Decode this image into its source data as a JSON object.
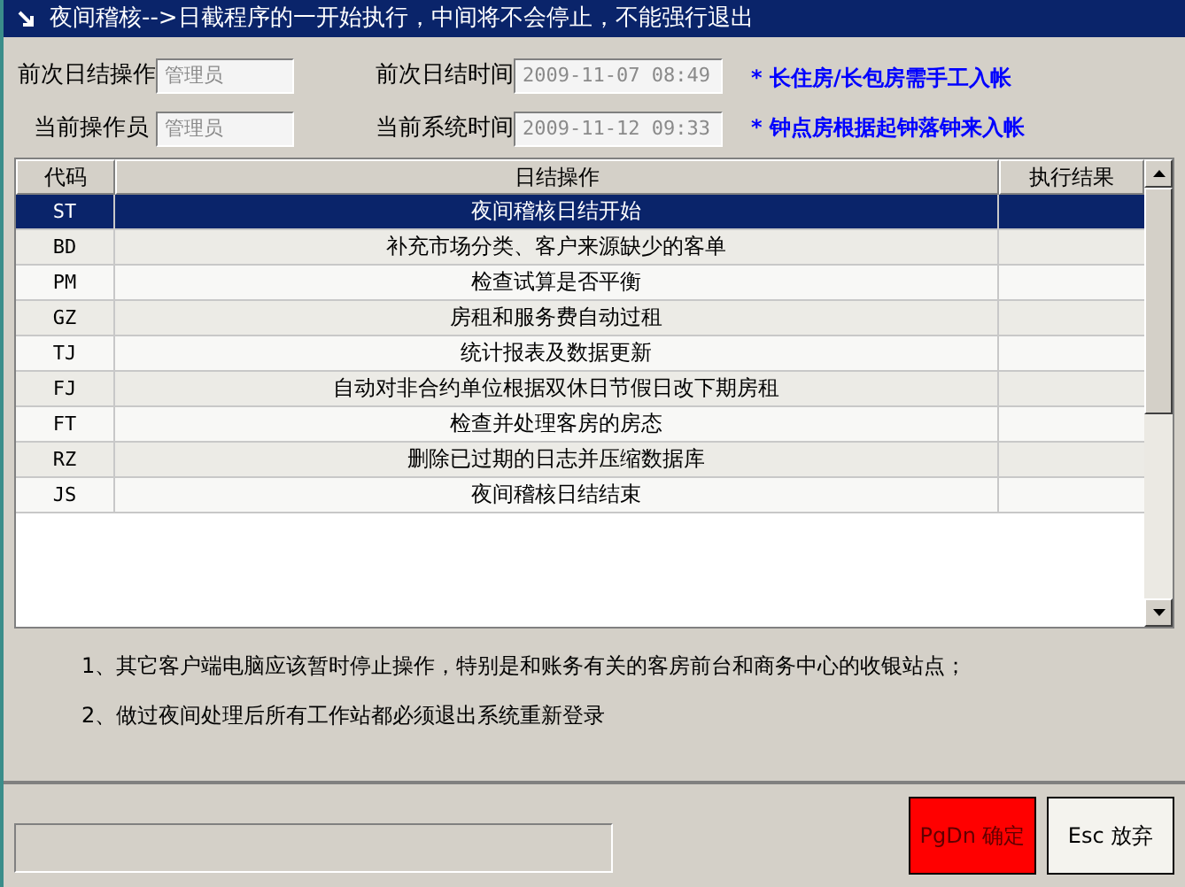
{
  "window": {
    "title": "夜间稽核-->日截程序的一开始执行，中间将不会停止，不能强行退出"
  },
  "fields": [
    {
      "label": "前次日结操作",
      "value": "管理员"
    },
    {
      "label": "前次日结时间",
      "value": "2009-11-07 08:49"
    },
    {
      "label": "当前操作员",
      "value": "管理员"
    },
    {
      "label": "当前系统时间",
      "value": "2009-11-12 09:33"
    }
  ],
  "notices": [
    "* 长住房/长包房需手工入帐",
    "* 钟点房根据起钟落钟来入帐"
  ],
  "table": {
    "columns": [
      "代码",
      "日结操作",
      "执行结果"
    ],
    "rows": [
      {
        "code": "ST",
        "operation": "夜间稽核日结开始",
        "selected": true
      },
      {
        "code": "BD",
        "operation": "补充市场分类、客户来源缺少的客单",
        "selected": false
      },
      {
        "code": "PM",
        "operation": "检查试算是否平衡",
        "selected": false
      },
      {
        "code": "GZ",
        "operation": "房租和服务费自动过租",
        "selected": false
      },
      {
        "code": "TJ",
        "operation": "统计报表及数据更新",
        "selected": false
      },
      {
        "code": "FJ",
        "operation": "自动对非合约单位根据双休日节假日改下期房租",
        "selected": false
      },
      {
        "code": "FT",
        "operation": "检查并处理客房的房态",
        "selected": false
      },
      {
        "code": "RZ",
        "operation": "删除已过期的日志并压缩数据库",
        "selected": false
      },
      {
        "code": "JS",
        "operation": "夜间稽核日结结束",
        "selected": false
      }
    ]
  },
  "notes": [
    "1、其它客户端电脑应该暂时停止操作，特别是和账务有关的客房前台和商务中心的收银站点；",
    "2、做过夜间处理后所有工作站都必须退出系统重新登录"
  ],
  "buttons": [
    {
      "label": "PgDn 确定",
      "kind": "primary"
    },
    {
      "label": "Esc 放弃",
      "kind": "normal"
    }
  ]
}
